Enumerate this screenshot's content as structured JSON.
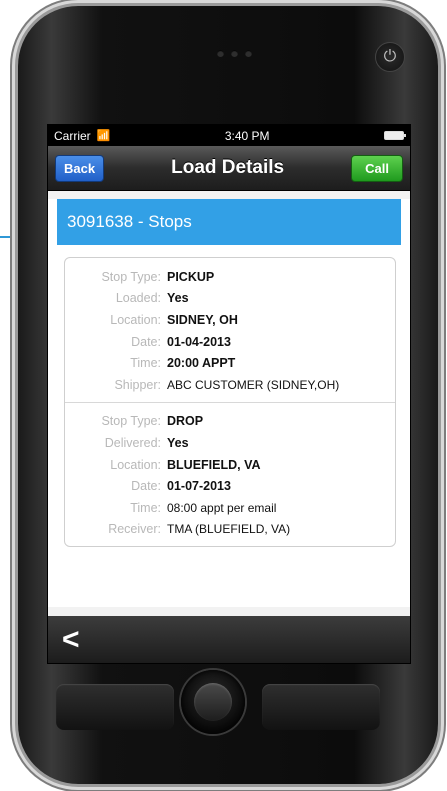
{
  "status_bar": {
    "carrier": "Carrier",
    "time": "3:40 PM"
  },
  "nav_bar": {
    "back_label": "Back",
    "title": "Load Details",
    "call_label": "Call"
  },
  "section": {
    "title": "3091638 - Stops"
  },
  "stops": [
    {
      "rows": [
        {
          "label": "Stop Type:",
          "value": "PICKUP"
        },
        {
          "label": "Loaded:",
          "value": "Yes"
        },
        {
          "label": "Location:",
          "value": "SIDNEY, OH"
        },
        {
          "label": "Date:",
          "value": "01-04-2013"
        },
        {
          "label": "Time:",
          "value": "20:00 APPT"
        },
        {
          "label": "Shipper:",
          "value": "ABC CUSTOMER (SIDNEY,OH)"
        }
      ]
    },
    {
      "rows": [
        {
          "label": "Stop Type:",
          "value": "DROP"
        },
        {
          "label": "Delivered:",
          "value": "Yes"
        },
        {
          "label": "Location:",
          "value": "BLUEFIELD, VA"
        },
        {
          "label": "Date:",
          "value": "01-07-2013"
        },
        {
          "label": "Time:",
          "value": "08:00 appt per email"
        },
        {
          "label": "Receiver:",
          "value": "TMA (BLUEFIELD, VA)"
        }
      ]
    }
  ],
  "toolbar": {
    "back_glyph": "<"
  },
  "colors": {
    "header_blue": "#32a0e6",
    "back_button": "#2f78d8",
    "call_button": "#3cb83a"
  },
  "icons": {
    "wifi": "wifi-icon",
    "battery": "battery-icon",
    "power": "power-icon",
    "back_arrow": "chevron-left-icon"
  }
}
